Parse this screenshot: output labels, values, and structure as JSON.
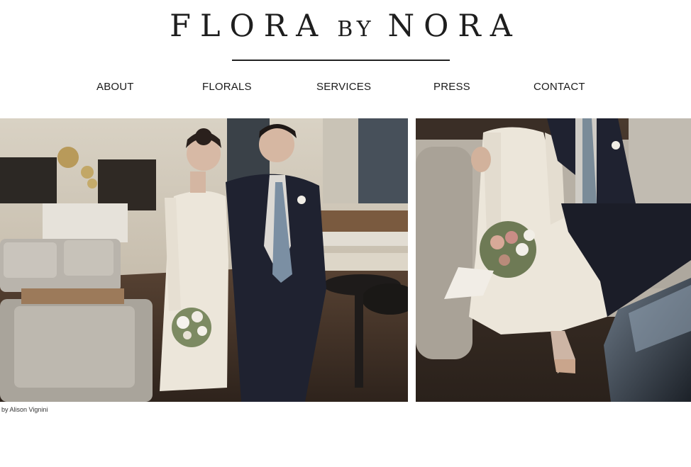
{
  "header": {
    "logo_part1": "FLORA",
    "logo_part2": "BY",
    "logo_part3": "NORA"
  },
  "nav": {
    "items": [
      {
        "label": "ABOUT"
      },
      {
        "label": "FLORALS"
      },
      {
        "label": "SERVICES"
      },
      {
        "label": "PRESS"
      },
      {
        "label": "CONTACT"
      }
    ]
  },
  "gallery": {
    "photo_1_subject": "couple-standing-in-lounge",
    "photo_2_subject": "couple-seated-with-bouquet",
    "credit": "by Alison Vignini"
  },
  "colors": {
    "background": "#ffffff",
    "text": "#1a1a1a",
    "dress": "#ece6da",
    "suit": "#1f2230"
  }
}
